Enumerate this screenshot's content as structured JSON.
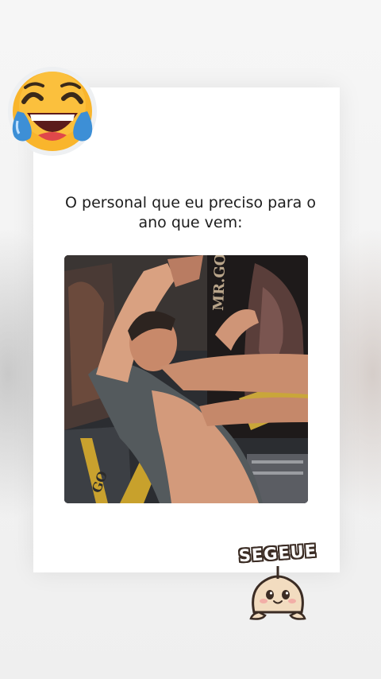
{
  "post": {
    "caption": "O personal que eu preciso para o\nano que vem:"
  },
  "stickers": {
    "top_left_emoji": "face-with-tears-of-joy-icon",
    "bottom_right_label": "SEGEUE"
  },
  "media": {
    "visible_text": [
      "MR.GO",
      "GO"
    ]
  },
  "colors": {
    "card_background": "#ffffff",
    "page_background": "#f3f3f3",
    "text": "#1d1d1d",
    "emoji_yellow": "#f9b52c",
    "tear_blue": "#3d8fd6",
    "sticker_outline": "#3b2c24"
  }
}
